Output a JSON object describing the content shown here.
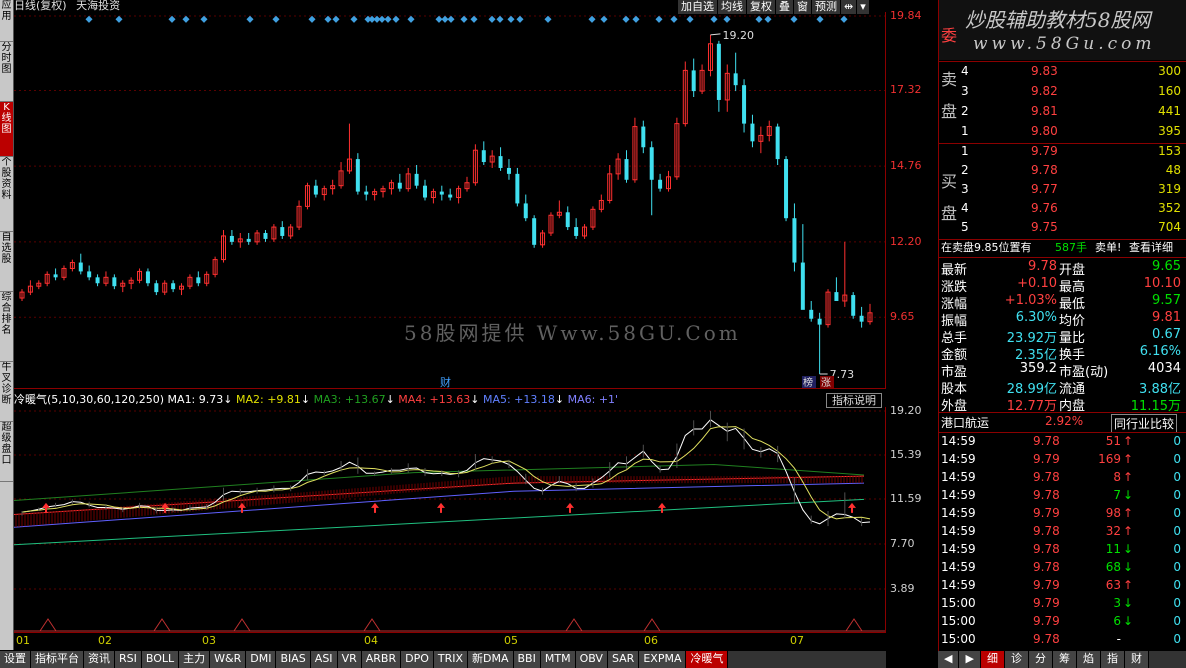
{
  "left_tabs": [
    "应用",
    "分时图",
    "K线图",
    "个股资料",
    "自选股",
    "综合排名",
    "牛叉诊断",
    "超级盘口"
  ],
  "topbar": {
    "title": "日线(复权)",
    "stock_name": "天海投资"
  },
  "toolbar": [
    "加自选",
    "均线",
    "复权",
    "叠",
    "窗",
    "预测",
    "⇹",
    "▾"
  ],
  "price_axis": [
    "19.84",
    "17.32",
    "14.76",
    "12.20",
    "9.65"
  ],
  "main_annotations": {
    "high": "19.20",
    "low": "7.73",
    "cai": "财",
    "bang": "榜",
    "zhang": "涨"
  },
  "indicator": {
    "name": "冷暖气(5,10,30,60,120,250)",
    "ma1": "MA1: 9.73",
    "ma2": "MA2: +9.81",
    "ma3": "MA3: +13.67",
    "ma4": "MA4: +13.63",
    "ma5": "MA5: +13.18",
    "ma6": "MA6: +1'",
    "button": "指标说明"
  },
  "sub_axis": [
    "19.20",
    "15.39",
    "11.59",
    "7.70",
    "3.89"
  ],
  "x_axis": [
    "01",
    "02",
    "03",
    "04",
    "05",
    "06",
    "07"
  ],
  "bottom_tabs": [
    "设置",
    "指标平台",
    "资讯",
    "RSI",
    "BOLL",
    "主力",
    "W&R",
    "DMI",
    "BIAS",
    "ASI",
    "VR",
    "ARBR",
    "DPO",
    "TRIX",
    "新DMA",
    "BBI",
    "MTM",
    "OBV",
    "SAR",
    "EXPMA",
    "冷暖气"
  ],
  "bottom_right_tabs": [
    "◀",
    "▶",
    "细",
    "诊",
    "分",
    "筹",
    "焰",
    "指",
    "财"
  ],
  "right": {
    "brand": "炒股辅助教材58股网",
    "site": "www.58Gu.com",
    "wei": "委",
    "mai_sell": "卖",
    "pan": "盘",
    "mai_buy": "买",
    "sell": [
      {
        "n": "4",
        "p": "9.83",
        "v": "300"
      },
      {
        "n": "3",
        "p": "9.82",
        "v": "160"
      },
      {
        "n": "2",
        "p": "9.81",
        "v": "441"
      },
      {
        "n": "1",
        "p": "9.80",
        "v": "395"
      }
    ],
    "buy": [
      {
        "n": "1",
        "p": "9.79",
        "v": "153"
      },
      {
        "n": "2",
        "p": "9.78",
        "v": "48"
      },
      {
        "n": "3",
        "p": "9.77",
        "v": "319"
      },
      {
        "n": "4",
        "p": "9.76",
        "v": "352"
      },
      {
        "n": "5",
        "p": "9.75",
        "v": "704"
      }
    ],
    "notice": {
      "a": "在卖盘9.85位置有",
      "b": "587手",
      "c": "卖单!",
      "d": "查看详细"
    },
    "quote": [
      {
        "l": "最新",
        "v": "9.78",
        "l2": "开盘",
        "v2": "9.65"
      },
      {
        "l": "涨跌",
        "v": "+0.10",
        "l2": "最高",
        "v2": "10.10"
      },
      {
        "l": "涨幅",
        "v": "+1.03%",
        "l2": "最低",
        "v2": "9.57"
      },
      {
        "l": "振幅",
        "v": "6.30%",
        "l2": "均价",
        "v2": "9.81"
      },
      {
        "l": "总手",
        "v": "23.92万",
        "l2": "量比",
        "v2": "0.67"
      },
      {
        "l": "金额",
        "v": "2.35亿",
        "l2": "换手",
        "v2": "6.16%"
      },
      {
        "l": "市盈",
        "v": "359.2",
        "l2": "市盈(动)",
        "v2": "4034"
      },
      {
        "l": "股本",
        "v": "28.99亿",
        "l2": "流通",
        "v2": "3.88亿"
      },
      {
        "l": "外盘",
        "v": "12.77万",
        "l2": "内盘",
        "v2": "11.15万"
      }
    ],
    "sector": {
      "name": "港口航运",
      "pct": "2.92%",
      "btn": "同行业比较"
    },
    "ticks": [
      {
        "t": "14:59",
        "p": "9.78",
        "v": "51",
        "d": "↑"
      },
      {
        "t": "14:59",
        "p": "9.79",
        "v": "169",
        "d": "↑"
      },
      {
        "t": "14:59",
        "p": "9.78",
        "v": "8",
        "d": "↑"
      },
      {
        "t": "14:59",
        "p": "9.78",
        "v": "7",
        "d": "↓"
      },
      {
        "t": "14:59",
        "p": "9.79",
        "v": "98",
        "d": "↑"
      },
      {
        "t": "14:59",
        "p": "9.78",
        "v": "32",
        "d": "↑"
      },
      {
        "t": "14:59",
        "p": "9.78",
        "v": "11",
        "d": "↓"
      },
      {
        "t": "14:59",
        "p": "9.78",
        "v": "68",
        "d": "↓"
      },
      {
        "t": "14:59",
        "p": "9.79",
        "v": "63",
        "d": "↑"
      },
      {
        "t": "15:00",
        "p": "9.79",
        "v": "3",
        "d": "↓"
      },
      {
        "t": "15:00",
        "p": "9.79",
        "v": "6",
        "d": "↓"
      },
      {
        "t": "15:00",
        "p": "9.78",
        "v": "-",
        "d": ""
      }
    ],
    "right_counts": [
      "0",
      "0",
      "0",
      "0",
      "0",
      "0",
      "0",
      "0",
      "0",
      "0",
      "0",
      "0"
    ]
  },
  "watermark": "58股网提供 Www.58GU.Com",
  "colors": {
    "up": "#ff3030",
    "down": "#40e0f0",
    "frame": "#8b0000"
  },
  "chart_data": {
    "type": "candlestick",
    "y_range": [
      7.73,
      19.84
    ],
    "candles": [
      [
        10.3,
        10.6,
        10.2,
        10.5
      ],
      [
        10.5,
        10.9,
        10.4,
        10.7
      ],
      [
        10.7,
        10.9,
        10.6,
        10.8
      ],
      [
        10.8,
        11.2,
        10.7,
        11.1
      ],
      [
        11.1,
        11.3,
        10.9,
        11.0
      ],
      [
        11.0,
        11.4,
        10.9,
        11.3
      ],
      [
        11.3,
        11.6,
        11.2,
        11.5
      ],
      [
        11.5,
        11.8,
        11.1,
        11.2
      ],
      [
        11.2,
        11.4,
        10.9,
        11.0
      ],
      [
        11.0,
        11.1,
        10.7,
        10.8
      ],
      [
        10.8,
        11.2,
        10.7,
        11.0
      ],
      [
        11.0,
        11.1,
        10.6,
        10.7
      ],
      [
        10.7,
        10.9,
        10.5,
        10.8
      ],
      [
        10.8,
        11.0,
        10.6,
        10.9
      ],
      [
        10.9,
        11.3,
        10.8,
        11.2
      ],
      [
        11.2,
        11.3,
        10.7,
        10.8
      ],
      [
        10.8,
        10.9,
        10.4,
        10.5
      ],
      [
        10.5,
        10.9,
        10.4,
        10.8
      ],
      [
        10.8,
        10.9,
        10.5,
        10.6
      ],
      [
        10.6,
        10.8,
        10.4,
        10.7
      ],
      [
        10.7,
        11.1,
        10.6,
        11.0
      ],
      [
        11.0,
        11.2,
        10.7,
        10.8
      ],
      [
        10.8,
        11.2,
        10.7,
        11.1
      ],
      [
        11.1,
        11.7,
        11.0,
        11.6
      ],
      [
        11.6,
        12.6,
        11.5,
        12.4
      ],
      [
        12.4,
        12.6,
        12.1,
        12.2
      ],
      [
        12.2,
        12.5,
        12.0,
        12.3
      ],
      [
        12.3,
        12.5,
        12.1,
        12.2
      ],
      [
        12.2,
        12.6,
        12.1,
        12.5
      ],
      [
        12.5,
        12.6,
        12.2,
        12.3
      ],
      [
        12.3,
        12.8,
        12.2,
        12.7
      ],
      [
        12.7,
        12.9,
        12.3,
        12.4
      ],
      [
        12.4,
        12.8,
        12.3,
        12.7
      ],
      [
        12.7,
        13.6,
        12.6,
        13.4
      ],
      [
        13.4,
        14.2,
        13.3,
        14.1
      ],
      [
        14.1,
        14.3,
        13.7,
        13.8
      ],
      [
        13.8,
        14.1,
        13.6,
        14.0
      ],
      [
        14.0,
        14.3,
        13.8,
        14.1
      ],
      [
        14.1,
        14.9,
        14.0,
        14.6
      ],
      [
        14.6,
        16.2,
        14.5,
        15.0
      ],
      [
        15.0,
        15.2,
        13.8,
        13.9
      ],
      [
        13.9,
        14.1,
        13.6,
        13.8
      ],
      [
        13.8,
        14.0,
        13.6,
        13.9
      ],
      [
        13.9,
        14.1,
        13.7,
        14.0
      ],
      [
        14.0,
        14.3,
        13.8,
        14.2
      ],
      [
        14.2,
        14.5,
        13.9,
        14.0
      ],
      [
        14.0,
        14.7,
        13.9,
        14.5
      ],
      [
        14.5,
        14.8,
        14.0,
        14.1
      ],
      [
        14.1,
        14.3,
        13.6,
        13.7
      ],
      [
        13.7,
        14.0,
        13.5,
        13.9
      ],
      [
        13.9,
        14.1,
        13.6,
        13.8
      ],
      [
        13.8,
        14.0,
        13.6,
        13.7
      ],
      [
        13.7,
        14.1,
        13.5,
        14.0
      ],
      [
        14.0,
        14.4,
        13.9,
        14.2
      ],
      [
        14.2,
        15.5,
        14.1,
        15.3
      ],
      [
        15.3,
        15.6,
        14.8,
        14.9
      ],
      [
        14.9,
        15.3,
        14.7,
        15.1
      ],
      [
        15.1,
        15.4,
        14.6,
        14.7
      ],
      [
        14.7,
        15.0,
        14.3,
        14.5
      ],
      [
        14.5,
        14.7,
        13.4,
        13.5
      ],
      [
        13.5,
        13.8,
        12.9,
        13.0
      ],
      [
        13.0,
        13.1,
        12.0,
        12.1
      ],
      [
        12.1,
        12.6,
        12.0,
        12.5
      ],
      [
        12.5,
        13.2,
        12.4,
        13.1
      ],
      [
        13.1,
        13.6,
        13.0,
        13.2
      ],
      [
        13.2,
        13.4,
        12.6,
        12.7
      ],
      [
        12.7,
        13.0,
        12.3,
        12.4
      ],
      [
        12.4,
        12.8,
        12.3,
        12.7
      ],
      [
        12.7,
        13.4,
        12.6,
        13.3
      ],
      [
        13.3,
        13.8,
        13.2,
        13.6
      ],
      [
        13.6,
        14.8,
        13.5,
        14.5
      ],
      [
        14.5,
        15.2,
        14.3,
        15.0
      ],
      [
        15.0,
        15.3,
        14.2,
        14.3
      ],
      [
        14.3,
        16.4,
        14.2,
        16.1
      ],
      [
        16.1,
        16.3,
        15.2,
        15.4
      ],
      [
        15.4,
        15.6,
        13.1,
        14.3
      ],
      [
        14.3,
        14.5,
        13.9,
        14.0
      ],
      [
        14.0,
        14.6,
        13.9,
        14.4
      ],
      [
        14.4,
        16.4,
        14.3,
        16.2
      ],
      [
        16.2,
        18.3,
        16.1,
        18.0
      ],
      [
        18.0,
        18.4,
        17.1,
        17.3
      ],
      [
        17.3,
        18.2,
        17.2,
        18.0
      ],
      [
        18.0,
        19.2,
        17.8,
        18.9
      ],
      [
        18.9,
        19.0,
        16.6,
        17.0
      ],
      [
        17.0,
        18.2,
        16.6,
        17.9
      ],
      [
        17.9,
        18.6,
        17.3,
        17.5
      ],
      [
        17.5,
        17.7,
        15.9,
        16.2
      ],
      [
        16.2,
        16.5,
        15.4,
        15.6
      ],
      [
        15.6,
        16.1,
        15.2,
        15.8
      ],
      [
        15.8,
        16.3,
        15.6,
        16.1
      ],
      [
        16.1,
        16.2,
        14.8,
        15.0
      ],
      [
        15.0,
        15.1,
        12.9,
        13.0
      ],
      [
        13.0,
        13.5,
        11.2,
        11.5
      ],
      [
        11.5,
        12.8,
        10.6,
        9.9
      ],
      [
        9.9,
        10.2,
        9.5,
        9.6
      ],
      [
        9.6,
        9.8,
        7.73,
        9.4
      ],
      [
        9.4,
        10.6,
        9.3,
        10.5
      ],
      [
        10.5,
        11.0,
        10.3,
        10.2
      ],
      [
        10.2,
        12.2,
        10.0,
        10.4
      ],
      [
        10.4,
        10.5,
        9.6,
        9.7
      ],
      [
        9.7,
        10.0,
        9.3,
        9.5
      ],
      [
        9.5,
        10.1,
        9.4,
        9.8
      ]
    ]
  }
}
